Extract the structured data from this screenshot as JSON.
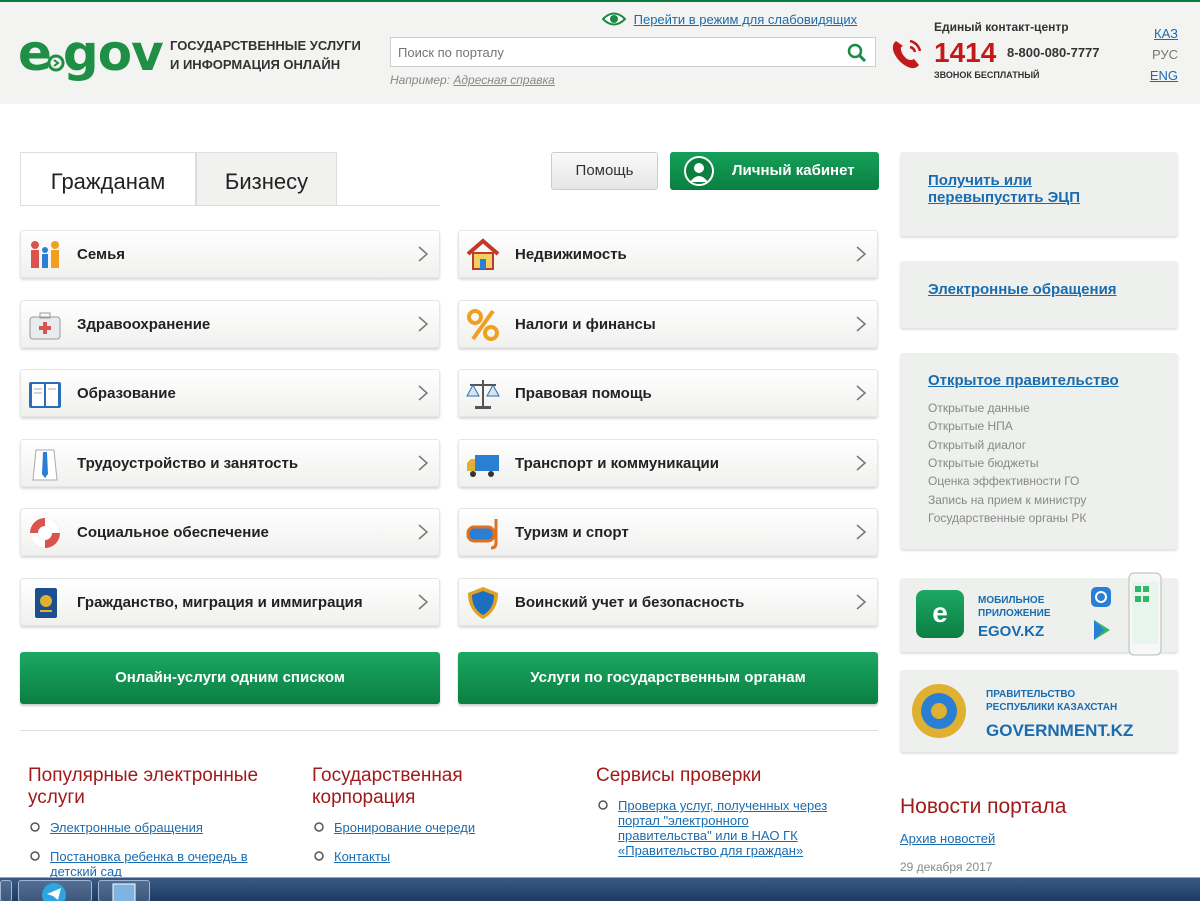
{
  "header": {
    "logo": {
      "e": "e",
      "gov": "gov"
    },
    "tagline_line1": "ГОСУДАРСТВЕННЫЕ УСЛУГИ",
    "tagline_line2": "И ИНФОРМАЦИЯ ОНЛАЙН",
    "low_vision_link": "Перейти в режим для слабовидящих",
    "search_placeholder": "Поиск по порталу",
    "search_example_prefix": "Например:",
    "search_example_link": "Адресная справка",
    "contact_title": "Единый контакт-центр",
    "contact_number": "1414",
    "contact_phone": "8-800-080-7777",
    "contact_free": "ЗВОНОК БЕСПЛАТНЫЙ",
    "languages": [
      "КАЗ",
      "РУС",
      "ENG"
    ]
  },
  "tabs": [
    {
      "label": "Гражданам",
      "active": true
    },
    {
      "label": "Бизнесу",
      "active": false
    }
  ],
  "actions": {
    "help": "Помощь",
    "cabinet": "Личный кабинет"
  },
  "categories_left": [
    {
      "label": "Семья",
      "icon": "family-icon"
    },
    {
      "label": "Здравоохранение",
      "icon": "first-aid-kit-icon"
    },
    {
      "label": "Образование",
      "icon": "book-icon"
    },
    {
      "label": "Трудоустройство и занятость",
      "icon": "shirt-tie-icon"
    },
    {
      "label": "Социальное обеспечение",
      "icon": "lifebuoy-icon"
    },
    {
      "label": "Гражданство, миграция и иммиграция",
      "icon": "passport-icon"
    }
  ],
  "categories_right": [
    {
      "label": "Недвижимость",
      "icon": "house-icon"
    },
    {
      "label": "Налоги и финансы",
      "icon": "percent-icon"
    },
    {
      "label": "Правовая помощь",
      "icon": "scales-icon"
    },
    {
      "label": "Транспорт и коммуникации",
      "icon": "truck-icon"
    },
    {
      "label": "Туризм и спорт",
      "icon": "diving-mask-icon"
    },
    {
      "label": "Воинский учет и безопасность",
      "icon": "shield-icon"
    }
  ],
  "big_buttons": {
    "online_services": "Онлайн-услуги одним списком",
    "gov_bodies": "Услуги по государственным органам"
  },
  "popular": {
    "title_line1": "Популярные электронные",
    "title_line2": "услуги",
    "links": [
      "Электронные обращения",
      "Постановка ребенка в очередь в",
      "детский сад"
    ]
  },
  "corporation": {
    "title_line1": "Государственная",
    "title_line2": "корпорация",
    "links": [
      "Бронирование очереди",
      "Контакты"
    ]
  },
  "verification": {
    "title": "Сервисы проверки",
    "link_lines": [
      "Проверка услуг, полученных через",
      "портал \"электронного",
      "правительства\" или в НАО ГК",
      "«Правительство для граждан»"
    ]
  },
  "sidebar": {
    "ecp_line1": "Получить или",
    "ecp_line2": "перевыпустить ЭЦП",
    "appeals": "Электронные обращения",
    "open_gov_title": "Открытое правительство",
    "open_gov_items": [
      "Открытые данные",
      "Открытые НПА",
      "Открытый диалог",
      "Открытые бюджеты",
      "Оценка эффективности ГО",
      "Запись на прием к министру",
      "Государственные органы РК"
    ],
    "mobile_line1": "МОБИЛЬНОЕ",
    "mobile_line2": "ПРИЛОЖЕНИЕ",
    "mobile_site": "EGOV.KZ",
    "gov_line1": "ПРАВИТЕЛЬСТВО",
    "gov_line2": "РЕСПУБЛИКИ КАЗАХСТАН",
    "gov_site": "GOVERNMENT.KZ"
  },
  "news": {
    "title": "Новости портала",
    "archive": "Архив новостей",
    "date": "29 декабря 2017"
  },
  "colors": {
    "brand_green": "#0e8a47",
    "link_blue": "#1a6cb0",
    "title_red": "#a01a1a",
    "hotline_red": "#c21a1a"
  }
}
